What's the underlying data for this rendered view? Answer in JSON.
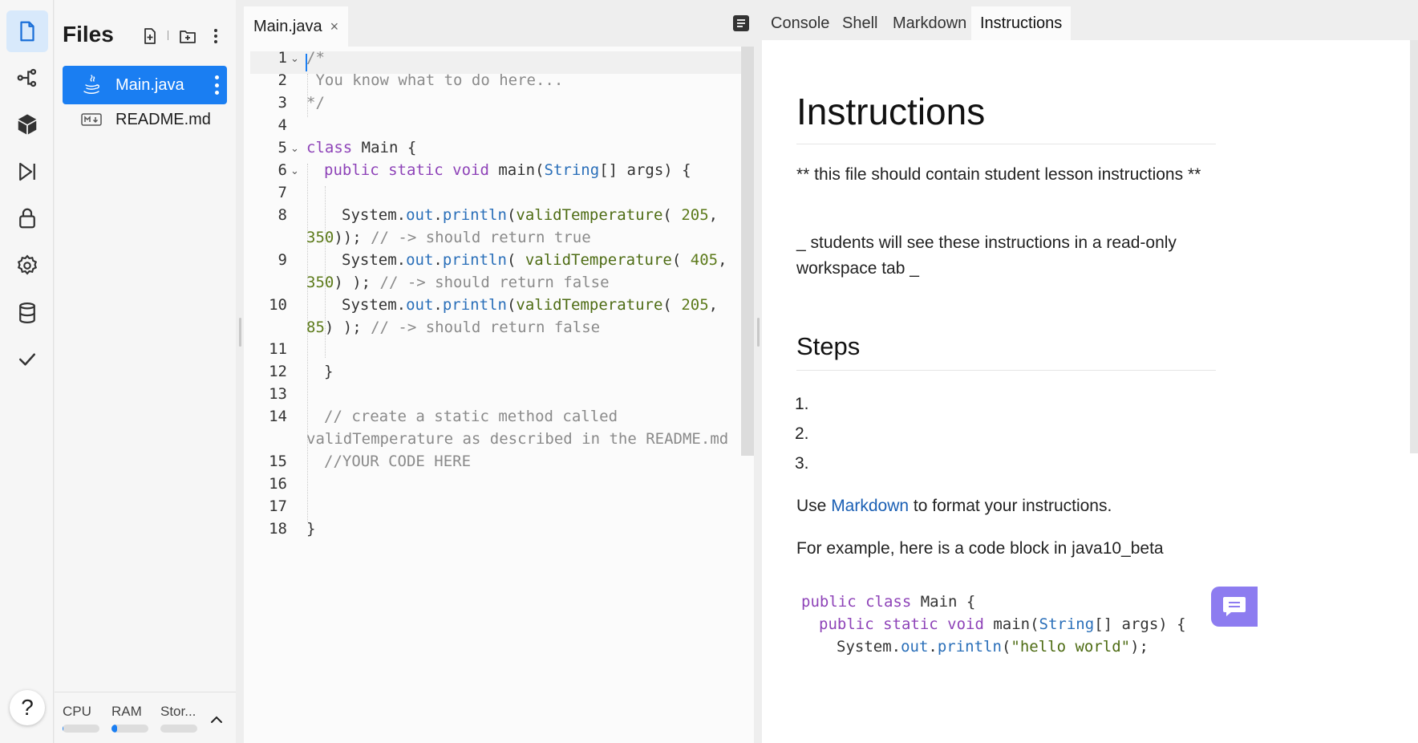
{
  "rail": {
    "items": [
      {
        "icon": "files-icon",
        "active": true
      },
      {
        "icon": "git-branch-icon",
        "active": false
      },
      {
        "icon": "packages-icon",
        "active": false
      },
      {
        "icon": "debugger-icon",
        "active": false
      },
      {
        "icon": "lock-icon",
        "active": false
      },
      {
        "icon": "gear-icon",
        "active": false
      },
      {
        "icon": "database-icon",
        "active": false
      },
      {
        "icon": "checkmark-icon",
        "active": false
      }
    ],
    "help_label": "?"
  },
  "files_panel": {
    "title": "Files",
    "files": [
      {
        "name": "Main.java",
        "icon": "java-icon",
        "active": true
      },
      {
        "name": "README.md",
        "icon": "markdown-icon",
        "active": false
      }
    ],
    "resources": [
      {
        "label": "CPU",
        "usage": 0.02
      },
      {
        "label": "RAM",
        "usage": 0.15
      },
      {
        "label": "Stor...",
        "usage": 0.0
      }
    ]
  },
  "editor": {
    "tab": {
      "label": "Main.java",
      "close": "×"
    },
    "line_numbers": [
      "1",
      "2",
      "3",
      "4",
      "5",
      "6",
      "7",
      "8",
      "9",
      "10",
      "11",
      "12",
      "13",
      "14",
      "15",
      "16",
      "17",
      "18"
    ],
    "lines": {
      "l1": "/*",
      "l2": " You know what to do here...",
      "l3": "*/",
      "l5_kw": "class",
      "l5_rest": " Main {",
      "l6_kw": "public static void",
      "l6_fn": " main(",
      "l6_type": "String",
      "l6_rest": "[] args) {",
      "l8_a": "System.",
      "l8_b": "out",
      "l8_c": ".",
      "l8_d": "println",
      "l8_e": "(",
      "l8_f": "validTemperature",
      "l8_g": "( ",
      "l8_h": "205",
      "l8_i": ",",
      "l8w_num": "350",
      "l8w_rest": ")); ",
      "l8w_cm": "// -> should return true",
      "l9_a": "System.",
      "l9_b": "out",
      "l9_c": ".",
      "l9_d": "println",
      "l9_e": "( ",
      "l9_f": "validTemperature",
      "l9_g": "( ",
      "l9_h": "405",
      "l9_i": ",",
      "l9w_num": "350",
      "l9w_rest": ") ); ",
      "l9w_cm": "// -> should return false",
      "l10_a": "System.",
      "l10_b": "out",
      "l10_c": ".",
      "l10_d": "println",
      "l10_e": "(",
      "l10_f": "validTemperature",
      "l10_g": "( ",
      "l10_h": "205",
      "l10_i": ",",
      "l10w_num": "85",
      "l10w_rest": ") ); ",
      "l10w_cm": "// -> should return false",
      "l12": "}",
      "l14": "// create a static method called",
      "l14w": "validTemperature as described in the README.md",
      "l15": "//YOUR CODE HERE",
      "l18": "}"
    }
  },
  "right_pane": {
    "tabs": [
      "Console",
      "Shell",
      "Markdown",
      "Instructions"
    ],
    "active_tab": "Instructions",
    "heading": "Instructions",
    "para1": "** this file should contain student lesson instructions **",
    "para2": "_ students will see these instructions in a read-only workspace tab _",
    "steps_heading": "Steps",
    "steps": [
      "1.",
      "2.",
      "3."
    ],
    "para3_before": "Use ",
    "para3_link": "Markdown",
    "para3_after": " to format your instructions.",
    "para4": "For example, here is a code block in java10_beta",
    "code_block": {
      "c1_kw": "public class",
      "c1_rest": " Main {",
      "c2_kw": "public static void",
      "c2_fn": " main(",
      "c2_type": "String",
      "c2_rest": "[] args) {",
      "c3_a": "System.",
      "c3_b": "out",
      "c3_c": ".",
      "c3_d": "println",
      "c3_e": "(",
      "c3_str": "\"hello world\"",
      "c3_f": ");"
    }
  },
  "colors": {
    "accent": "#1a7ef2",
    "chat": "#8d7cf0",
    "keyword": "#8e43b8",
    "type": "#2a6fb9",
    "number": "#5c7a1a",
    "comment": "#8a8a8a"
  }
}
